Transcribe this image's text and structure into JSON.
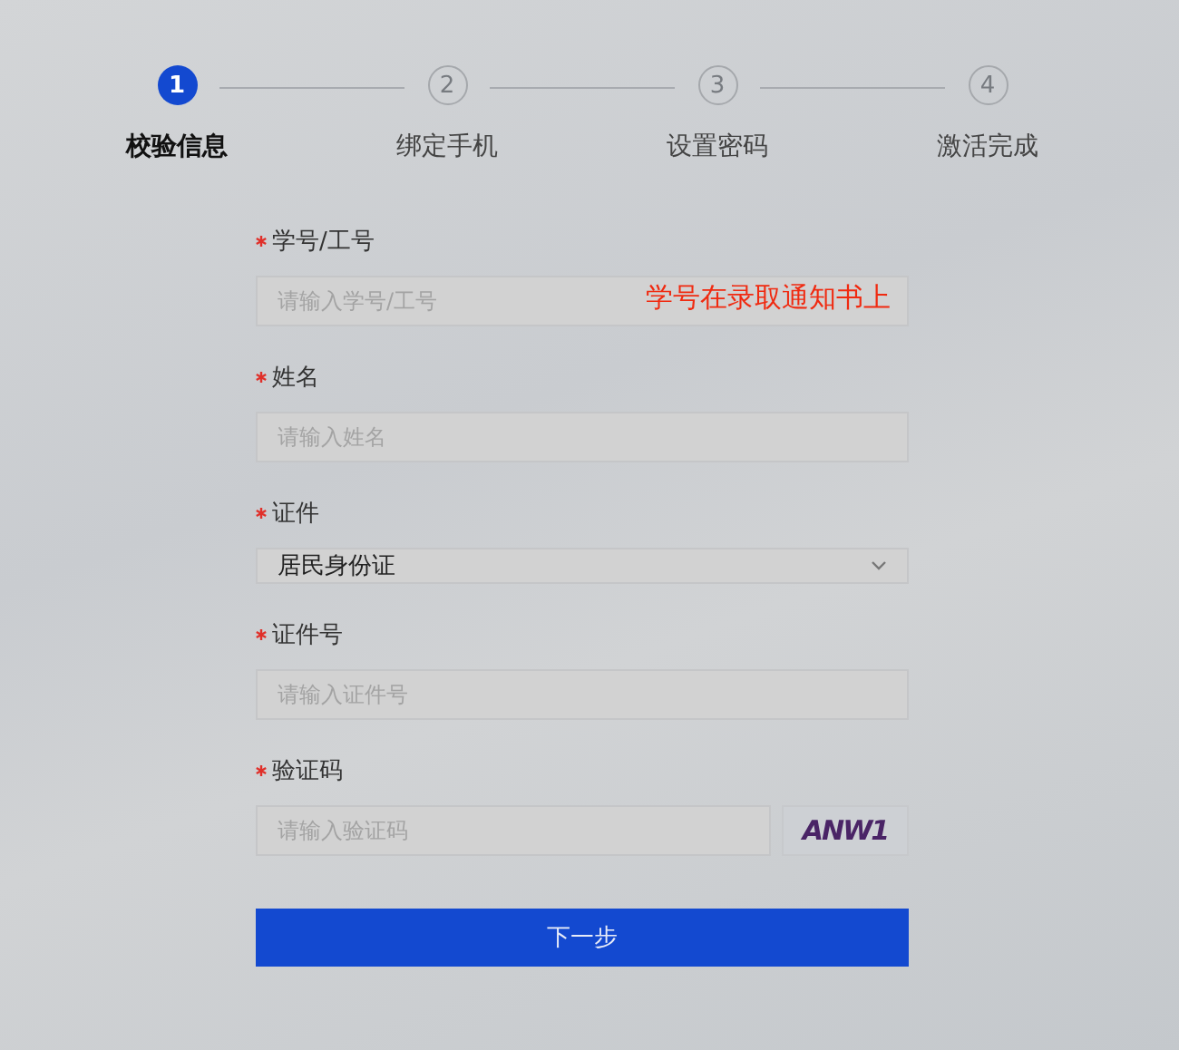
{
  "steps": [
    {
      "number": "1",
      "label": "校验信息",
      "selected": true
    },
    {
      "number": "2",
      "label": "绑定手机",
      "selected": false
    },
    {
      "number": "3",
      "label": "设置密码",
      "selected": false
    },
    {
      "number": "4",
      "label": "激活完成",
      "selected": false
    }
  ],
  "fields": [
    {
      "kind": "input",
      "label": "学号/工号",
      "required": true,
      "placeholder": "请输入学号/工号",
      "note": "学号在录取通知书上"
    },
    {
      "kind": "input",
      "label": "姓名",
      "required": true,
      "placeholder": "请输入姓名"
    },
    {
      "kind": "select",
      "label": "证件",
      "required": true,
      "value": "居民身份证"
    },
    {
      "kind": "input",
      "label": "证件号",
      "required": true,
      "placeholder": "请输入证件号"
    },
    {
      "kind": "captcha",
      "label": "验证码",
      "required": true,
      "placeholder": "请输入验证码",
      "captcha": "ANW1"
    }
  ],
  "submit": "下一步"
}
